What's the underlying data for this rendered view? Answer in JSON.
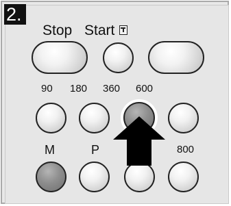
{
  "step_number": "2.",
  "labels": {
    "stop": "Stop",
    "start": "Start",
    "b90": "90",
    "b180": "180",
    "b360": "360",
    "b600": "600",
    "m": "M",
    "p": "P",
    "b800": "800"
  },
  "icons": {
    "start_icon": "start-symbol-icon",
    "pointer": "pointing-arrow-icon"
  },
  "colors": {
    "button_light": "#e8e8e8",
    "button_dark": "#8e8e8e",
    "badge_bg": "#111111",
    "badge_text": "#ffffff",
    "arrow": "#000000"
  },
  "highlighted_button": "600"
}
